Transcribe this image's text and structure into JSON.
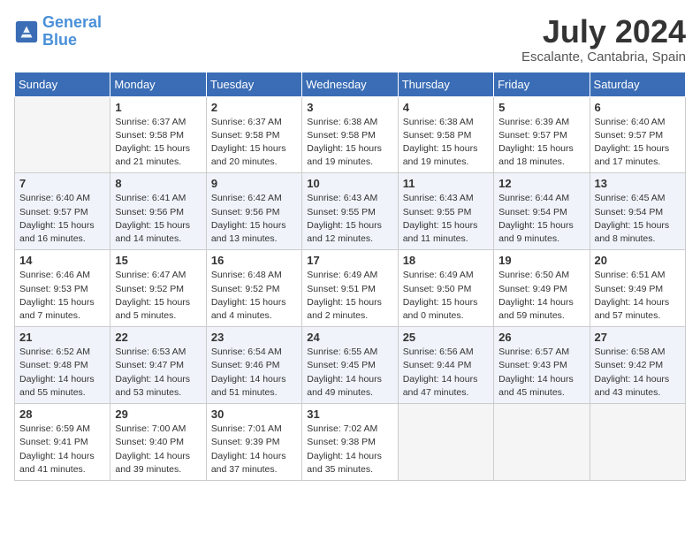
{
  "logo": {
    "line1": "General",
    "line2": "Blue"
  },
  "title": "July 2024",
  "location": "Escalante, Cantabria, Spain",
  "weekdays": [
    "Sunday",
    "Monday",
    "Tuesday",
    "Wednesday",
    "Thursday",
    "Friday",
    "Saturday"
  ],
  "weeks": [
    [
      {
        "day": "",
        "info": ""
      },
      {
        "day": "1",
        "info": "Sunrise: 6:37 AM\nSunset: 9:58 PM\nDaylight: 15 hours\nand 21 minutes."
      },
      {
        "day": "2",
        "info": "Sunrise: 6:37 AM\nSunset: 9:58 PM\nDaylight: 15 hours\nand 20 minutes."
      },
      {
        "day": "3",
        "info": "Sunrise: 6:38 AM\nSunset: 9:58 PM\nDaylight: 15 hours\nand 19 minutes."
      },
      {
        "day": "4",
        "info": "Sunrise: 6:38 AM\nSunset: 9:58 PM\nDaylight: 15 hours\nand 19 minutes."
      },
      {
        "day": "5",
        "info": "Sunrise: 6:39 AM\nSunset: 9:57 PM\nDaylight: 15 hours\nand 18 minutes."
      },
      {
        "day": "6",
        "info": "Sunrise: 6:40 AM\nSunset: 9:57 PM\nDaylight: 15 hours\nand 17 minutes."
      }
    ],
    [
      {
        "day": "7",
        "info": "Sunrise: 6:40 AM\nSunset: 9:57 PM\nDaylight: 15 hours\nand 16 minutes."
      },
      {
        "day": "8",
        "info": "Sunrise: 6:41 AM\nSunset: 9:56 PM\nDaylight: 15 hours\nand 14 minutes."
      },
      {
        "day": "9",
        "info": "Sunrise: 6:42 AM\nSunset: 9:56 PM\nDaylight: 15 hours\nand 13 minutes."
      },
      {
        "day": "10",
        "info": "Sunrise: 6:43 AM\nSunset: 9:55 PM\nDaylight: 15 hours\nand 12 minutes."
      },
      {
        "day": "11",
        "info": "Sunrise: 6:43 AM\nSunset: 9:55 PM\nDaylight: 15 hours\nand 11 minutes."
      },
      {
        "day": "12",
        "info": "Sunrise: 6:44 AM\nSunset: 9:54 PM\nDaylight: 15 hours\nand 9 minutes."
      },
      {
        "day": "13",
        "info": "Sunrise: 6:45 AM\nSunset: 9:54 PM\nDaylight: 15 hours\nand 8 minutes."
      }
    ],
    [
      {
        "day": "14",
        "info": "Sunrise: 6:46 AM\nSunset: 9:53 PM\nDaylight: 15 hours\nand 7 minutes."
      },
      {
        "day": "15",
        "info": "Sunrise: 6:47 AM\nSunset: 9:52 PM\nDaylight: 15 hours\nand 5 minutes."
      },
      {
        "day": "16",
        "info": "Sunrise: 6:48 AM\nSunset: 9:52 PM\nDaylight: 15 hours\nand 4 minutes."
      },
      {
        "day": "17",
        "info": "Sunrise: 6:49 AM\nSunset: 9:51 PM\nDaylight: 15 hours\nand 2 minutes."
      },
      {
        "day": "18",
        "info": "Sunrise: 6:49 AM\nSunset: 9:50 PM\nDaylight: 15 hours\nand 0 minutes."
      },
      {
        "day": "19",
        "info": "Sunrise: 6:50 AM\nSunset: 9:49 PM\nDaylight: 14 hours\nand 59 minutes."
      },
      {
        "day": "20",
        "info": "Sunrise: 6:51 AM\nSunset: 9:49 PM\nDaylight: 14 hours\nand 57 minutes."
      }
    ],
    [
      {
        "day": "21",
        "info": "Sunrise: 6:52 AM\nSunset: 9:48 PM\nDaylight: 14 hours\nand 55 minutes."
      },
      {
        "day": "22",
        "info": "Sunrise: 6:53 AM\nSunset: 9:47 PM\nDaylight: 14 hours\nand 53 minutes."
      },
      {
        "day": "23",
        "info": "Sunrise: 6:54 AM\nSunset: 9:46 PM\nDaylight: 14 hours\nand 51 minutes."
      },
      {
        "day": "24",
        "info": "Sunrise: 6:55 AM\nSunset: 9:45 PM\nDaylight: 14 hours\nand 49 minutes."
      },
      {
        "day": "25",
        "info": "Sunrise: 6:56 AM\nSunset: 9:44 PM\nDaylight: 14 hours\nand 47 minutes."
      },
      {
        "day": "26",
        "info": "Sunrise: 6:57 AM\nSunset: 9:43 PM\nDaylight: 14 hours\nand 45 minutes."
      },
      {
        "day": "27",
        "info": "Sunrise: 6:58 AM\nSunset: 9:42 PM\nDaylight: 14 hours\nand 43 minutes."
      }
    ],
    [
      {
        "day": "28",
        "info": "Sunrise: 6:59 AM\nSunset: 9:41 PM\nDaylight: 14 hours\nand 41 minutes."
      },
      {
        "day": "29",
        "info": "Sunrise: 7:00 AM\nSunset: 9:40 PM\nDaylight: 14 hours\nand 39 minutes."
      },
      {
        "day": "30",
        "info": "Sunrise: 7:01 AM\nSunset: 9:39 PM\nDaylight: 14 hours\nand 37 minutes."
      },
      {
        "day": "31",
        "info": "Sunrise: 7:02 AM\nSunset: 9:38 PM\nDaylight: 14 hours\nand 35 minutes."
      },
      {
        "day": "",
        "info": ""
      },
      {
        "day": "",
        "info": ""
      },
      {
        "day": "",
        "info": ""
      }
    ]
  ]
}
